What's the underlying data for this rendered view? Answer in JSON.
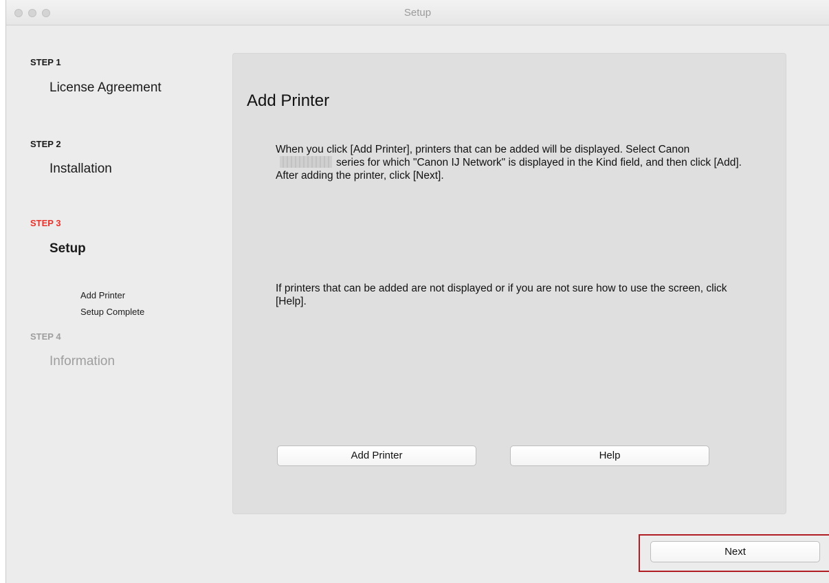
{
  "window": {
    "title": "Setup"
  },
  "sidebar": {
    "steps": [
      {
        "label": "STEP 1",
        "name": "License Agreement",
        "state": "done"
      },
      {
        "label": "STEP 2",
        "name": "Installation",
        "state": "done"
      },
      {
        "label": "STEP 3",
        "name": "Setup",
        "state": "active",
        "substeps": [
          "Add Printer",
          "Setup Complete"
        ]
      },
      {
        "label": "STEP 4",
        "name": "Information",
        "state": "disabled"
      }
    ]
  },
  "main": {
    "title": "Add Printer",
    "paragraph1": {
      "before": "When you click [Add Printer], printers that can be added will be displayed. Select Canon",
      "after": "series for which \"Canon IJ Network\" is displayed in the Kind field, and then click [Add].",
      "line2": "After adding the printer, click [Next]."
    },
    "paragraph2": "If printers that can be added are not displayed or if you are not sure how to use the screen, click [Help].",
    "buttons": {
      "add_printer": "Add Printer",
      "help": "Help"
    }
  },
  "footer": {
    "next": "Next"
  },
  "colors": {
    "active_step": "#e8322b",
    "highlight_border": "#b01e24",
    "panel_bg": "#dfdfdf",
    "window_bg": "#ececec"
  }
}
